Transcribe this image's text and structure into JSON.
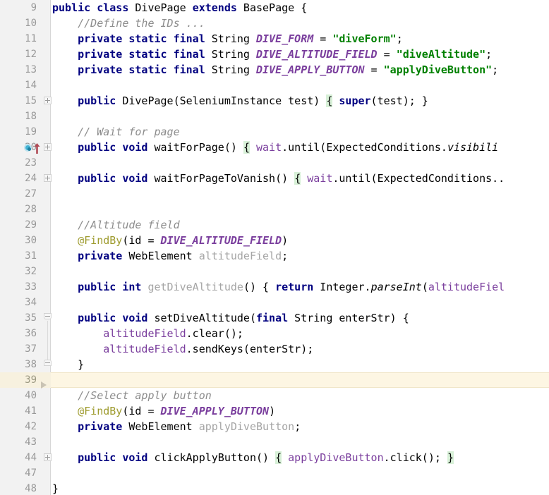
{
  "editor": {
    "language": "java",
    "file_class": "DivePage",
    "font": "monospace",
    "colors": {
      "background": "#ffffff",
      "gutter_background": "#f2f2f2",
      "gutter_separator": "#d6d6d6",
      "line_number": "#999999",
      "keyword": "#000080",
      "string": "#008000",
      "comment": "#8c8c8c",
      "constant": "#7a3e9d",
      "field": "#7a3e9d",
      "annotation": "#9e9b2e",
      "unused_symbol": "#a5a5a5",
      "caret_line": "#fdf6e3",
      "brace_match": "#d7f0d7",
      "implements_marker": "#44b3d4",
      "override_arrow": "#b04a55"
    },
    "gutter_icons": {
      "fold_collapsed": "plus-box-icon",
      "fold_region_start": "fold-start-icon",
      "fold_region_end": "fold-end-icon",
      "implements_marker": "implemented-method-icon",
      "override_arrow": "override-arrow-icon",
      "run_marker": "run-triangle-icon"
    },
    "lines": [
      {
        "num": "9",
        "fold": "none",
        "current": false,
        "tokens": [
          {
            "t": "",
            "c": "plain"
          },
          {
            "t": "public",
            "c": "kw"
          },
          {
            "t": " ",
            "c": "plain"
          },
          {
            "t": "class",
            "c": "kw"
          },
          {
            "t": " DivePage ",
            "c": "plain"
          },
          {
            "t": "extends",
            "c": "kw"
          },
          {
            "t": " BasePage {",
            "c": "plain"
          }
        ]
      },
      {
        "num": "10",
        "fold": "none",
        "current": false,
        "tokens": [
          {
            "t": "    //Define the IDs ...",
            "c": "cmt"
          }
        ]
      },
      {
        "num": "11",
        "fold": "none",
        "current": false,
        "tokens": [
          {
            "t": "    ",
            "c": "plain"
          },
          {
            "t": "private static final",
            "c": "kw"
          },
          {
            "t": " String ",
            "c": "plain"
          },
          {
            "t": "DIVE_FORM",
            "c": "cnst"
          },
          {
            "t": " = ",
            "c": "plain"
          },
          {
            "t": "\"diveForm\"",
            "c": "str"
          },
          {
            "t": ";",
            "c": "plain"
          }
        ]
      },
      {
        "num": "12",
        "fold": "none",
        "current": false,
        "tokens": [
          {
            "t": "    ",
            "c": "plain"
          },
          {
            "t": "private static final",
            "c": "kw"
          },
          {
            "t": " String ",
            "c": "plain"
          },
          {
            "t": "DIVE_ALTITUDE_FIELD",
            "c": "cnst"
          },
          {
            "t": " = ",
            "c": "plain"
          },
          {
            "t": "\"diveAltitude\"",
            "c": "str"
          },
          {
            "t": ";",
            "c": "plain"
          }
        ]
      },
      {
        "num": "13",
        "fold": "none",
        "current": false,
        "tokens": [
          {
            "t": "    ",
            "c": "plain"
          },
          {
            "t": "private static final",
            "c": "kw"
          },
          {
            "t": " String ",
            "c": "plain"
          },
          {
            "t": "DIVE_APPLY_BUTTON",
            "c": "cnst"
          },
          {
            "t": " = ",
            "c": "plain"
          },
          {
            "t": "\"applyDiveButton\"",
            "c": "str"
          },
          {
            "t": ";",
            "c": "plain"
          }
        ]
      },
      {
        "num": "14",
        "fold": "none",
        "current": false,
        "tokens": []
      },
      {
        "num": "15",
        "fold": "collapsed",
        "current": false,
        "tokens": [
          {
            "t": "    ",
            "c": "plain"
          },
          {
            "t": "public",
            "c": "kw"
          },
          {
            "t": " DivePage(SeleniumInstance test) ",
            "c": "plain"
          },
          {
            "t": "{",
            "c": "brace-hl"
          },
          {
            "t": " ",
            "c": "plain"
          },
          {
            "t": "super",
            "c": "kw"
          },
          {
            "t": "(test); ",
            "c": "plain"
          },
          {
            "t": "}",
            "c": "plain"
          }
        ]
      },
      {
        "num": "18",
        "fold": "none",
        "current": false,
        "tokens": []
      },
      {
        "num": "19",
        "fold": "none",
        "current": false,
        "tokens": [
          {
            "t": "    // Wait for page",
            "c": "cmt"
          }
        ]
      },
      {
        "num": "20",
        "fold": "collapsed",
        "marker": "implements",
        "current": false,
        "tokens": [
          {
            "t": "    ",
            "c": "plain"
          },
          {
            "t": "public void",
            "c": "kw"
          },
          {
            "t": " waitForPage() ",
            "c": "plain"
          },
          {
            "t": "{",
            "c": "brace-hl"
          },
          {
            "t": " ",
            "c": "plain"
          },
          {
            "t": "wait",
            "c": "fld"
          },
          {
            "t": ".until(ExpectedConditions.",
            "c": "plain"
          },
          {
            "t": "visibili",
            "c": "stat"
          }
        ]
      },
      {
        "num": "23",
        "fold": "none",
        "current": false,
        "tokens": []
      },
      {
        "num": "24",
        "fold": "collapsed",
        "current": false,
        "tokens": [
          {
            "t": "    ",
            "c": "plain"
          },
          {
            "t": "public void",
            "c": "kw"
          },
          {
            "t": " waitForPageToVanish() ",
            "c": "plain"
          },
          {
            "t": "{",
            "c": "brace-hl"
          },
          {
            "t": " ",
            "c": "plain"
          },
          {
            "t": "wait",
            "c": "fld"
          },
          {
            "t": ".until(ExpectedConditions..",
            "c": "plain"
          }
        ]
      },
      {
        "num": "27",
        "fold": "none",
        "current": false,
        "tokens": []
      },
      {
        "num": "28",
        "fold": "none",
        "current": false,
        "tokens": []
      },
      {
        "num": "29",
        "fold": "none",
        "current": false,
        "tokens": [
          {
            "t": "    //Altitude field",
            "c": "cmt"
          }
        ]
      },
      {
        "num": "30",
        "fold": "none",
        "current": false,
        "tokens": [
          {
            "t": "    ",
            "c": "plain"
          },
          {
            "t": "@FindBy",
            "c": "anno"
          },
          {
            "t": "(id = ",
            "c": "plain"
          },
          {
            "t": "DIVE_ALTITUDE_FIELD",
            "c": "cnst"
          },
          {
            "t": ")",
            "c": "plain"
          }
        ]
      },
      {
        "num": "31",
        "fold": "none",
        "current": false,
        "tokens": [
          {
            "t": "    ",
            "c": "plain"
          },
          {
            "t": "private",
            "c": "kw"
          },
          {
            "t": " WebElement ",
            "c": "plain"
          },
          {
            "t": "altitudeField",
            "c": "grey"
          },
          {
            "t": ";",
            "c": "plain"
          }
        ]
      },
      {
        "num": "32",
        "fold": "none",
        "current": false,
        "tokens": []
      },
      {
        "num": "33",
        "fold": "none",
        "current": false,
        "tokens": [
          {
            "t": "    ",
            "c": "plain"
          },
          {
            "t": "public int",
            "c": "kw"
          },
          {
            "t": " ",
            "c": "plain"
          },
          {
            "t": "getDiveAltitude",
            "c": "grey"
          },
          {
            "t": "() { ",
            "c": "plain"
          },
          {
            "t": "return",
            "c": "kw"
          },
          {
            "t": " Integer.",
            "c": "plain"
          },
          {
            "t": "parseInt",
            "c": "stat"
          },
          {
            "t": "(",
            "c": "plain"
          },
          {
            "t": "altitudeFiel",
            "c": "fld"
          }
        ]
      },
      {
        "num": "34",
        "fold": "none",
        "current": false,
        "tokens": []
      },
      {
        "num": "35",
        "fold": "region-start",
        "current": false,
        "tokens": [
          {
            "t": "    ",
            "c": "plain"
          },
          {
            "t": "public void",
            "c": "kw"
          },
          {
            "t": " setDiveAltitude(",
            "c": "plain"
          },
          {
            "t": "final",
            "c": "kw"
          },
          {
            "t": " String enterStr) {",
            "c": "plain"
          }
        ]
      },
      {
        "num": "36",
        "fold": "region-mid",
        "current": false,
        "tokens": [
          {
            "t": "        ",
            "c": "plain"
          },
          {
            "t": "altitudeField",
            "c": "fld"
          },
          {
            "t": ".clear();",
            "c": "plain"
          }
        ]
      },
      {
        "num": "37",
        "fold": "region-mid",
        "current": false,
        "tokens": [
          {
            "t": "        ",
            "c": "plain"
          },
          {
            "t": "altitudeField",
            "c": "fld"
          },
          {
            "t": ".sendKeys(enterStr);",
            "c": "plain"
          }
        ]
      },
      {
        "num": "38",
        "fold": "region-end",
        "current": false,
        "tokens": [
          {
            "t": "    }",
            "c": "plain"
          }
        ]
      },
      {
        "num": "39",
        "fold": "none",
        "current": true,
        "marker": "run",
        "tokens": []
      },
      {
        "num": "40",
        "fold": "none",
        "current": false,
        "tokens": [
          {
            "t": "    //Select apply button",
            "c": "cmt"
          }
        ]
      },
      {
        "num": "41",
        "fold": "none",
        "current": false,
        "tokens": [
          {
            "t": "    ",
            "c": "plain"
          },
          {
            "t": "@FindBy",
            "c": "anno"
          },
          {
            "t": "(id = ",
            "c": "plain"
          },
          {
            "t": "DIVE_APPLY_BUTTON",
            "c": "cnst"
          },
          {
            "t": ")",
            "c": "plain"
          }
        ]
      },
      {
        "num": "42",
        "fold": "none",
        "current": false,
        "tokens": [
          {
            "t": "    ",
            "c": "plain"
          },
          {
            "t": "private",
            "c": "kw"
          },
          {
            "t": " WebElement ",
            "c": "plain"
          },
          {
            "t": "applyDiveButton",
            "c": "grey"
          },
          {
            "t": ";",
            "c": "plain"
          }
        ]
      },
      {
        "num": "43",
        "fold": "none",
        "current": false,
        "tokens": []
      },
      {
        "num": "44",
        "fold": "collapsed",
        "current": false,
        "tokens": [
          {
            "t": "    ",
            "c": "plain"
          },
          {
            "t": "public void",
            "c": "kw"
          },
          {
            "t": " clickApplyButton() ",
            "c": "plain"
          },
          {
            "t": "{",
            "c": "brace-hl"
          },
          {
            "t": " ",
            "c": "plain"
          },
          {
            "t": "applyDiveButton",
            "c": "fld"
          },
          {
            "t": ".click(); ",
            "c": "plain"
          },
          {
            "t": "}",
            "c": "brace-hl"
          }
        ]
      },
      {
        "num": "47",
        "fold": "none",
        "current": false,
        "tokens": []
      },
      {
        "num": "48",
        "fold": "none",
        "current": false,
        "tokens": [
          {
            "t": "}",
            "c": "plain"
          }
        ]
      }
    ]
  }
}
